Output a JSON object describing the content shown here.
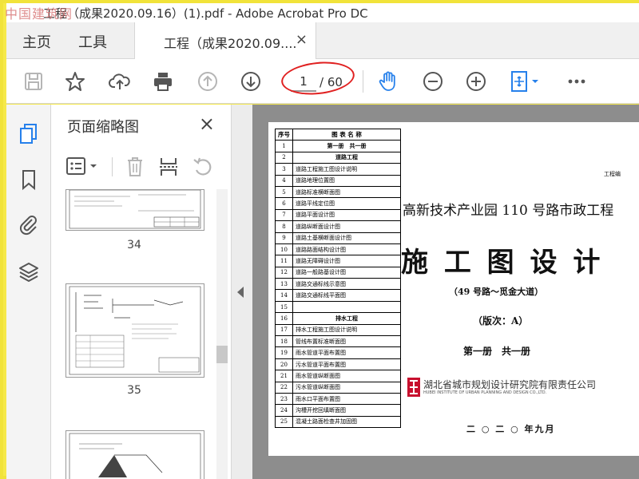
{
  "app": {
    "watermark": "中国建筑网",
    "window_title": "工程（成果2020.09.16）(1).pdf - Adobe Acrobat Pro DC"
  },
  "tabs": {
    "home": "主页",
    "tools": "工具",
    "document": "工程（成果2020.09....",
    "close": "×"
  },
  "toolbar": {
    "current_page": "1",
    "total_pages": "/ 60",
    "icons": [
      "save-icon",
      "bookmark-star-icon",
      "upload-cloud-icon",
      "print-icon",
      "page-up-icon",
      "page-down-icon",
      "hand-tool-icon",
      "zoom-out-icon",
      "zoom-in-icon",
      "fit-page-icon",
      "more-icon"
    ],
    "accent": "#2680eb",
    "annotation_color": "#e02020"
  },
  "sidebar_rail": {
    "icons": [
      "page-thumbnails-icon",
      "bookmarks-icon",
      "attachments-icon",
      "layers-icon"
    ]
  },
  "thumbnails": {
    "title": "页面缩略图",
    "close": "×",
    "pages": [
      "34",
      "35"
    ]
  },
  "document": {
    "toc_headers": [
      "序号",
      "图 表 名 称"
    ],
    "toc_rows": [
      {
        "no": "1",
        "name": "第一册　共一册",
        "center": true
      },
      {
        "no": "2",
        "name": "道路工程",
        "center": true
      },
      {
        "no": "3",
        "name": "道路工程施工图设计说明"
      },
      {
        "no": "4",
        "name": "道路地理位置图"
      },
      {
        "no": "5",
        "name": "道路标准横断面图"
      },
      {
        "no": "6",
        "name": "道路平线定位图"
      },
      {
        "no": "7",
        "name": "道路平面设计图"
      },
      {
        "no": "8",
        "name": "道路纵断面设计图"
      },
      {
        "no": "9",
        "name": "道路土基横断面设计图"
      },
      {
        "no": "10",
        "name": "道路路面结构设计图"
      },
      {
        "no": "11",
        "name": "道路无障碍设计图"
      },
      {
        "no": "12",
        "name": "道路一般路基设计图"
      },
      {
        "no": "13",
        "name": "道路交通标线示意图"
      },
      {
        "no": "14",
        "name": "道路交通标线平面图"
      },
      {
        "no": "15",
        "name": ""
      },
      {
        "no": "16",
        "name": "排水工程",
        "center": true
      },
      {
        "no": "17",
        "name": "排水工程施工图设计说明"
      },
      {
        "no": "18",
        "name": "管线布置标准断面图"
      },
      {
        "no": "19",
        "name": "雨水管道平面布置图"
      },
      {
        "no": "20",
        "name": "污水管道平面布置图"
      },
      {
        "no": "21",
        "name": "雨水管道纵断面图"
      },
      {
        "no": "22",
        "name": "污水管道纵断面图"
      },
      {
        "no": "23",
        "name": "雨水口平面布置图"
      },
      {
        "no": "24",
        "name": "沟槽开挖回填断面图"
      },
      {
        "no": "25",
        "name": "混凝土路面检查井加固图"
      }
    ],
    "corner_label": "工程编",
    "project_title": "高新技术产业园 110 号路市政工程",
    "design_title": "施 工 图 设 计",
    "section": "（49 号路～觅金大道）",
    "version": "（版次：A）",
    "volume": "第一册　共一册",
    "institute_cn": "湖北省城市规划设计研究院有限责任公司",
    "institute_en": "HUBEI INSTITUTE OF URBAN PLANNING AND DESIGN CO.,LTD.",
    "date": "二 ○ 二 ○ 年九月"
  }
}
